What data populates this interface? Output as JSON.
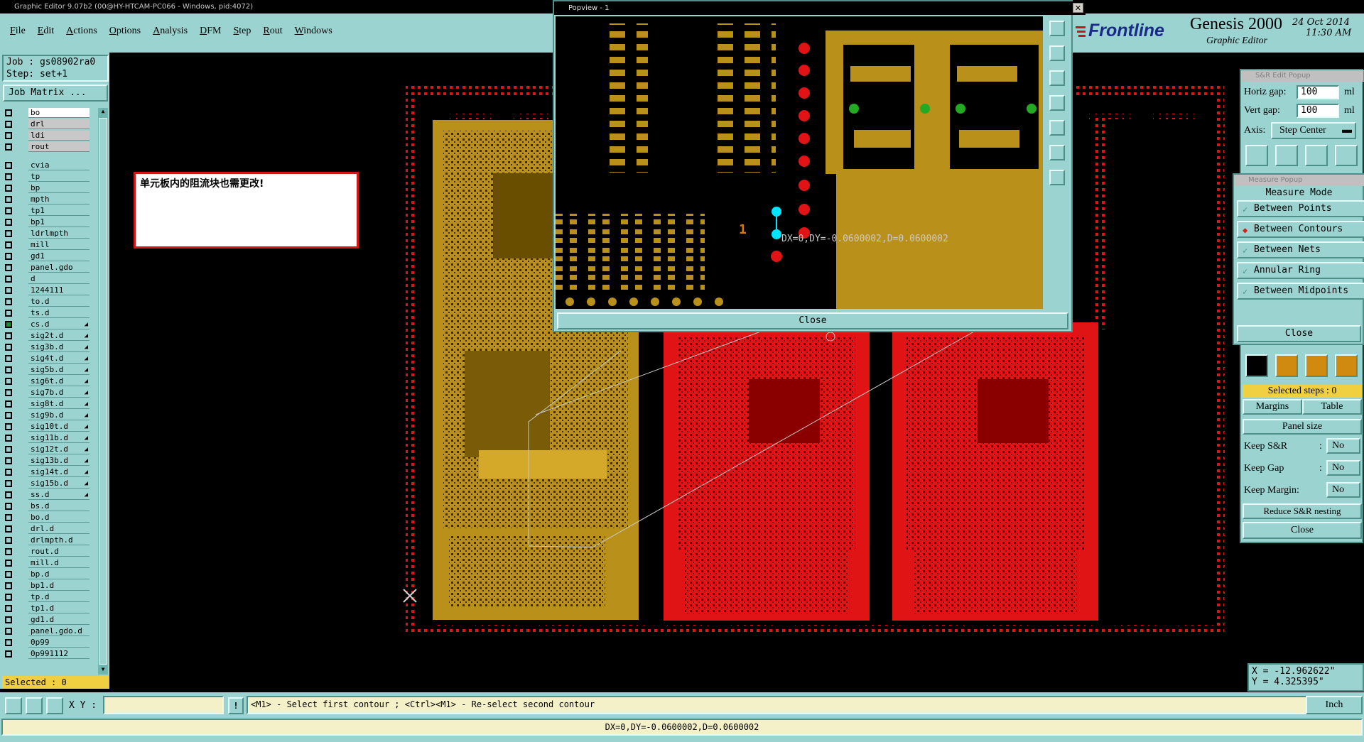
{
  "window": {
    "title": "Graphic Editor 9.07b2 (00@HY-HTCAM-PC066 - Windows, pid:4072)",
    "menu": [
      "File",
      "Edit",
      "Actions",
      "Options",
      "Analysis",
      "DFM",
      "Step",
      "Rout",
      "Windows"
    ]
  },
  "brand": {
    "logo": "Frontline",
    "product": "Genesis 2000",
    "subtitle": "Graphic Editor",
    "date": "24 Oct 2014",
    "time": "11:30 AM"
  },
  "job": {
    "job_text": "Job : gs08902ra0",
    "step_text": "Step: set+1",
    "job_matrix_label": "Job Matrix ...",
    "selected_text": "Selected : 0"
  },
  "layers": [
    {
      "name": "bo",
      "arrow": ""
    },
    {
      "name": "drl",
      "arrow": ""
    },
    {
      "name": "ldi",
      "arrow": ""
    },
    {
      "name": "rout",
      "arrow": ""
    },
    {
      "name": "cvia",
      "arrow": ""
    },
    {
      "name": "tp",
      "arrow": ""
    },
    {
      "name": "bp",
      "arrow": ""
    },
    {
      "name": "mpth",
      "arrow": ""
    },
    {
      "name": "tp1",
      "arrow": ""
    },
    {
      "name": "bp1",
      "arrow": ""
    },
    {
      "name": "ldrlmpth",
      "arrow": ""
    },
    {
      "name": "mill",
      "arrow": ""
    },
    {
      "name": "gd1",
      "arrow": ""
    },
    {
      "name": "panel.gdo",
      "arrow": ""
    },
    {
      "name": "d",
      "arrow": ""
    },
    {
      "name": "1244111",
      "arrow": ""
    },
    {
      "name": "to.d",
      "arrow": ""
    },
    {
      "name": "ts.d",
      "arrow": ""
    },
    {
      "name": "cs.d",
      "arrow": "◢"
    },
    {
      "name": "sig2t.d",
      "arrow": "◢"
    },
    {
      "name": "sig3b.d",
      "arrow": "◢"
    },
    {
      "name": "sig4t.d",
      "arrow": "◢"
    },
    {
      "name": "sig5b.d",
      "arrow": "◢"
    },
    {
      "name": "sig6t.d",
      "arrow": "◢"
    },
    {
      "name": "sig7b.d",
      "arrow": "◢"
    },
    {
      "name": "sig8t.d",
      "arrow": "◢"
    },
    {
      "name": "sig9b.d",
      "arrow": "◢"
    },
    {
      "name": "sig10t.d",
      "arrow": "◢"
    },
    {
      "name": "sig11b.d",
      "arrow": "◢"
    },
    {
      "name": "sig12t.d",
      "arrow": "◢"
    },
    {
      "name": "sig13b.d",
      "arrow": "◢"
    },
    {
      "name": "sig14t.d",
      "arrow": "◢"
    },
    {
      "name": "sig15b.d",
      "arrow": "◢"
    },
    {
      "name": "ss.d",
      "arrow": "◢"
    },
    {
      "name": "bs.d",
      "arrow": ""
    },
    {
      "name": "bo.d",
      "arrow": ""
    },
    {
      "name": "drl.d",
      "arrow": ""
    },
    {
      "name": "drlmpth.d",
      "arrow": ""
    },
    {
      "name": "rout.d",
      "arrow": ""
    },
    {
      "name": "mill.d",
      "arrow": ""
    },
    {
      "name": "bp.d",
      "arrow": ""
    },
    {
      "name": "bp1.d",
      "arrow": ""
    },
    {
      "name": "tp.d",
      "arrow": ""
    },
    {
      "name": "tp1.d",
      "arrow": ""
    },
    {
      "name": "gd1.d",
      "arrow": ""
    },
    {
      "name": "panel.gdo.d",
      "arrow": ""
    },
    {
      "name": "0p99",
      "arrow": ""
    },
    {
      "name": "0p991112",
      "arrow": ""
    }
  ],
  "note": {
    "text": "单元板内的阻流块也需更改!"
  },
  "popview": {
    "title": "Popview - 1",
    "measure_label": "DX=0,DY=-0.0600002,D=0.0600002",
    "label_one": "1",
    "close_label": "Close"
  },
  "sr_popup": {
    "title": "S&R Edit Popup",
    "horiz_label": "Horiz gap:",
    "horiz_value": "100",
    "horiz_unit": "ml",
    "vert_label": "Vert  gap:",
    "vert_value": "100",
    "vert_unit": "ml",
    "axis_label": "Axis:",
    "axis_value": "Step Center",
    "selected_steps": "Selected steps : 0",
    "margins_label": "Margins",
    "table_label": "Table",
    "panel_size_label": "Panel size",
    "keep_sr_label": "Keep S&R",
    "keep_sr_value": "No",
    "keep_gap_label": "Keep Gap",
    "keep_gap_value": "No",
    "keep_margin_label": "Keep Margin:",
    "keep_margin_value": "No",
    "reduce_label": "Reduce S&R nesting",
    "close_label": "Close"
  },
  "measure_popup": {
    "title": "Measure Popup",
    "header": "Measure Mode",
    "modes": [
      {
        "label": "Between Points",
        "selected": false
      },
      {
        "label": "Between Contours",
        "selected": true
      },
      {
        "label": "Between Nets",
        "selected": false
      },
      {
        "label": "Annular Ring",
        "selected": false
      },
      {
        "label": "Between Midpoints",
        "selected": false
      }
    ],
    "close_label": "Close"
  },
  "coords": {
    "x_text": "X = -12.962622\"",
    "y_text": "Y = 4.325395\""
  },
  "statusbar": {
    "xy_label": "X Y :",
    "xy_value": "",
    "prompt": "<M1> - Select first contour ; <Ctrl><M1> - Re-select second contour",
    "unit": "Inch",
    "bottom_text": "DX=0,DY=-0.0600002,D=0.0600002"
  },
  "colors": {
    "panel_teal": "#9ad3cf",
    "board_gold": "#b8901a",
    "board_red": "#e01414",
    "note_border": "#d01818",
    "measure_cyan": "#00e5ff"
  }
}
